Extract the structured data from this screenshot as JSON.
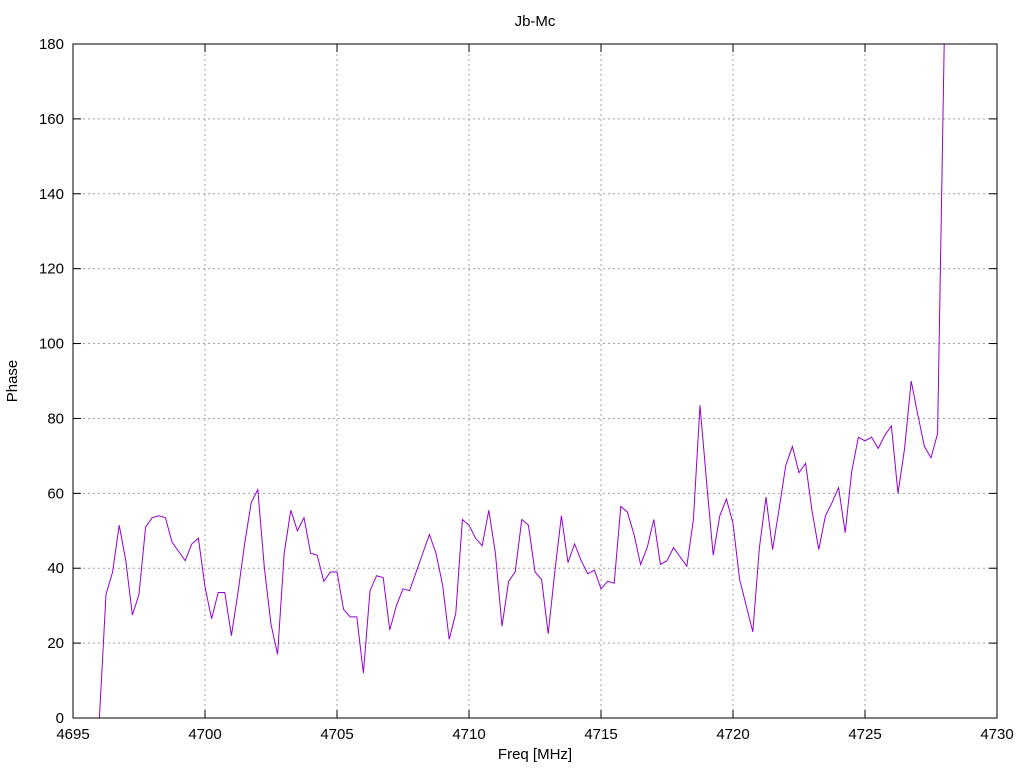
{
  "chart_data": {
    "type": "line",
    "title": "Jb-Mc",
    "xlabel": "Freq [MHz]",
    "ylabel": "Phase",
    "xlim": [
      4695,
      4730
    ],
    "ylim": [
      0,
      180
    ],
    "x_ticks": [
      "4695",
      "4700",
      "4705",
      "4710",
      "4715",
      "4720",
      "4725",
      "4730"
    ],
    "y_ticks": [
      "0",
      "20",
      "40",
      "60",
      "80",
      "100",
      "120",
      "140",
      "160",
      "180"
    ],
    "grid": true,
    "line_color": "#9400d3",
    "series": [
      {
        "x": [
          4696.0,
          4696.25,
          4696.5,
          4696.75,
          4697.0,
          4697.25,
          4697.5,
          4697.75,
          4698.0,
          4698.25,
          4698.5,
          4698.75,
          4699.0,
          4699.25,
          4699.5,
          4699.75,
          4700.0,
          4700.25,
          4700.5,
          4700.75,
          4701.0,
          4701.25,
          4701.5,
          4701.75,
          4702.0,
          4702.25,
          4702.5,
          4702.75,
          4703.0,
          4703.25,
          4703.5,
          4703.75,
          4704.0,
          4704.25,
          4704.5,
          4704.75,
          4705.0,
          4705.25,
          4705.5,
          4705.75,
          4706.0,
          4706.25,
          4706.5,
          4706.75,
          4707.0,
          4707.25,
          4707.5,
          4707.75,
          4708.0,
          4708.25,
          4708.5,
          4708.75,
          4709.0,
          4709.25,
          4709.5,
          4709.75,
          4710.0,
          4710.25,
          4710.5,
          4710.75,
          4711.0,
          4711.25,
          4711.5,
          4711.75,
          4712.0,
          4712.25,
          4712.5,
          4712.75,
          4713.0,
          4713.25,
          4713.5,
          4713.75,
          4714.0,
          4714.25,
          4714.5,
          4714.75,
          4715.0,
          4715.25,
          4715.5,
          4715.75,
          4716.0,
          4716.25,
          4716.5,
          4716.75,
          4717.0,
          4717.25,
          4717.5,
          4717.75,
          4718.0,
          4718.25,
          4718.5,
          4718.75,
          4719.0,
          4719.25,
          4719.5,
          4719.75,
          4720.0,
          4720.25,
          4720.5,
          4720.75,
          4721.0,
          4721.25,
          4721.5,
          4721.75,
          4722.0,
          4722.25,
          4722.5,
          4722.75,
          4723.0,
          4723.25,
          4723.5,
          4723.75,
          4724.0,
          4724.25,
          4724.5,
          4724.75,
          4725.0,
          4725.25,
          4725.5,
          4725.75,
          4726.0,
          4726.25,
          4726.5,
          4726.75,
          4727.0,
          4727.25,
          4727.5,
          4727.75,
          4728.0
        ],
        "values": [
          0,
          33,
          39,
          51.5,
          42,
          27.5,
          33,
          51,
          53.5,
          54,
          53.5,
          47,
          44.5,
          42,
          46.5,
          48,
          35,
          26.5,
          33.5,
          33.5,
          22,
          33.5,
          46.5,
          57.5,
          61,
          40,
          25,
          17,
          44,
          55.5,
          50,
          53.5,
          44,
          43.5,
          36.5,
          39,
          39,
          29,
          27,
          27,
          12,
          34,
          38,
          37.5,
          23.5,
          30,
          34.5,
          34,
          39,
          44,
          49,
          44,
          35.5,
          21,
          28,
          53,
          51.5,
          48,
          46,
          55.5,
          44,
          24.5,
          36.5,
          39,
          53,
          51.5,
          39,
          37,
          22.5,
          39,
          54,
          41.5,
          46.5,
          42,
          38.5,
          39.5,
          34.5,
          36.5,
          36,
          56.5,
          55,
          49,
          41,
          45.5,
          53,
          41,
          42,
          45.5,
          43,
          40.5,
          53,
          83.5,
          63,
          43.5,
          54,
          58.5,
          52,
          37,
          30,
          23,
          45.5,
          59,
          45,
          56,
          67.5,
          72.5,
          65.5,
          68,
          55,
          45,
          54,
          57.5,
          61.5,
          49.5,
          66,
          75,
          74,
          75,
          72,
          75.5,
          78,
          60,
          72,
          90,
          81,
          72.5,
          69.5,
          76,
          180
        ]
      }
    ]
  }
}
